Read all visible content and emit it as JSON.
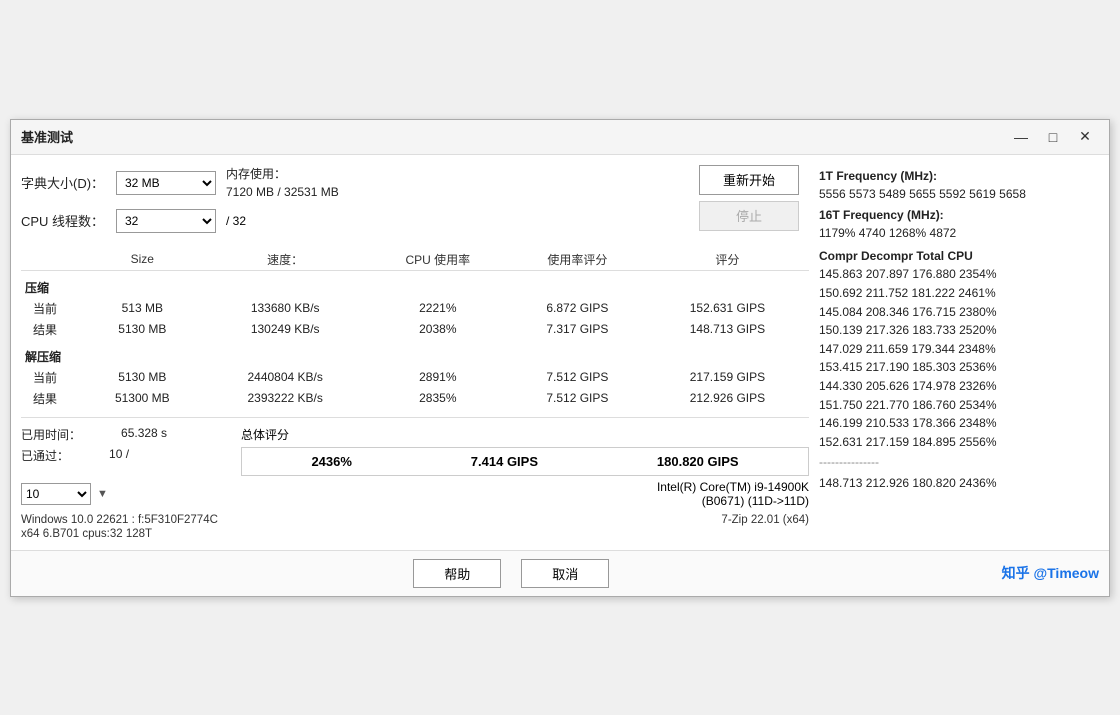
{
  "window": {
    "title": "基准测试",
    "controls": {
      "minimize": "—",
      "maximize": "□",
      "close": "✕"
    }
  },
  "form": {
    "dict_size_label": "字典大小(D)：",
    "dict_size_value": "32 MB",
    "mem_usage_label": "内存使用：",
    "mem_usage_value": "7120 MB / 32531 MB",
    "cpu_threads_label": "CPU 线程数：",
    "cpu_threads_value": "32",
    "cpu_threads_max": "/ 32",
    "restart_btn": "重新开始",
    "stop_btn": "停止"
  },
  "table": {
    "headers": [
      "Size",
      "速度：",
      "CPU 使用率",
      "使用率评分",
      "评分"
    ],
    "compression_label": "压缩",
    "current_label": "当前",
    "result_label": "结果",
    "decompression_label": "解压缩",
    "rows": {
      "compress_current": [
        "513 MB",
        "133680 KB/s",
        "2221%",
        "6.872 GIPS",
        "152.631 GIPS"
      ],
      "compress_result": [
        "5130 MB",
        "130249 KB/s",
        "2038%",
        "7.317 GIPS",
        "148.713 GIPS"
      ],
      "decompress_current": [
        "5130 MB",
        "2440804 KB/s",
        "2891%",
        "7.512 GIPS",
        "217.159 GIPS"
      ],
      "decompress_result": [
        "51300 MB",
        "2393222 KB/s",
        "2835%",
        "7.512 GIPS",
        "212.926 GIPS"
      ]
    }
  },
  "summary": {
    "label": "总体评分",
    "cpu_usage": "2436%",
    "usage_score": "7.414 GIPS",
    "total_score": "180.820 GIPS"
  },
  "status": {
    "elapsed_label": "已用时间：",
    "elapsed_value": "65.328 s",
    "passed_label": "已通过：",
    "passed_value": "10 /",
    "dropdown_value": "10"
  },
  "cpu_info": {
    "line1": "Intel(R) Core(TM) i9-14900K",
    "line2": "(B0671) (11D->11D)"
  },
  "system_info": {
    "os": "Windows 10.0 22621 : f:5F310F2774C",
    "app": "7-Zip 22.01 (x64)",
    "arch": "x64 6.B701 cpus:32 128T"
  },
  "footer": {
    "help_btn": "帮助",
    "cancel_btn": "取消",
    "watermark": "知乎 @Timeow"
  },
  "right_panel": {
    "freq_1t_label": "1T Frequency (MHz):",
    "freq_1t_values": "5556 5573 5489 5655 5592 5619 5658",
    "freq_16t_label": "16T Frequency (MHz):",
    "freq_16t_values": " 1179% 4740 1268% 4872",
    "col_headers": "Compr Decompr Total   CPU",
    "rows": [
      "145.863  207.897  176.880  2354%",
      "150.692  211.752  181.222  2461%",
      "145.084  208.346  176.715  2380%",
      "150.139  217.326  183.733  2520%",
      "147.029  211.659  179.344  2348%",
      "153.415  217.190  185.303  2536%",
      "144.330  205.626  174.978  2326%",
      "151.750  221.770  186.760  2534%",
      "146.199  210.533  178.366  2348%",
      "152.631  217.159  184.895  2556%"
    ],
    "separator": "---------------",
    "total_row": "148.713  212.926  180.820  2436%"
  }
}
